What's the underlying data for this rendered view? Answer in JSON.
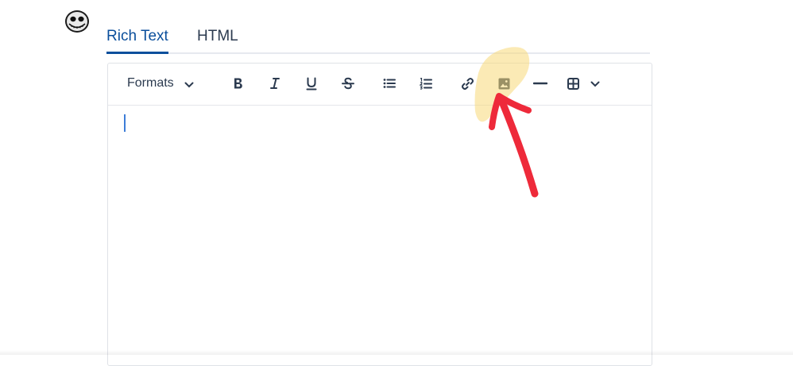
{
  "tabs": [
    {
      "label": "Rich Text",
      "active": true
    },
    {
      "label": "HTML",
      "active": false
    }
  ],
  "toolbar": {
    "formats_label": "Formats",
    "buttons": [
      "bold-icon",
      "italic-icon",
      "underline-icon",
      "strikethrough-icon",
      "bullet-list-icon",
      "numbered-list-icon",
      "link-icon",
      "image-icon",
      "horizontal-rule-icon",
      "table-icon"
    ]
  },
  "colors": {
    "accent": "#0b4f9c",
    "icon": "#2b3a4f",
    "caret": "#3d7dd8",
    "annotation_arrow": "#ee2a3a",
    "annotation_highlight": "#f7d878"
  }
}
